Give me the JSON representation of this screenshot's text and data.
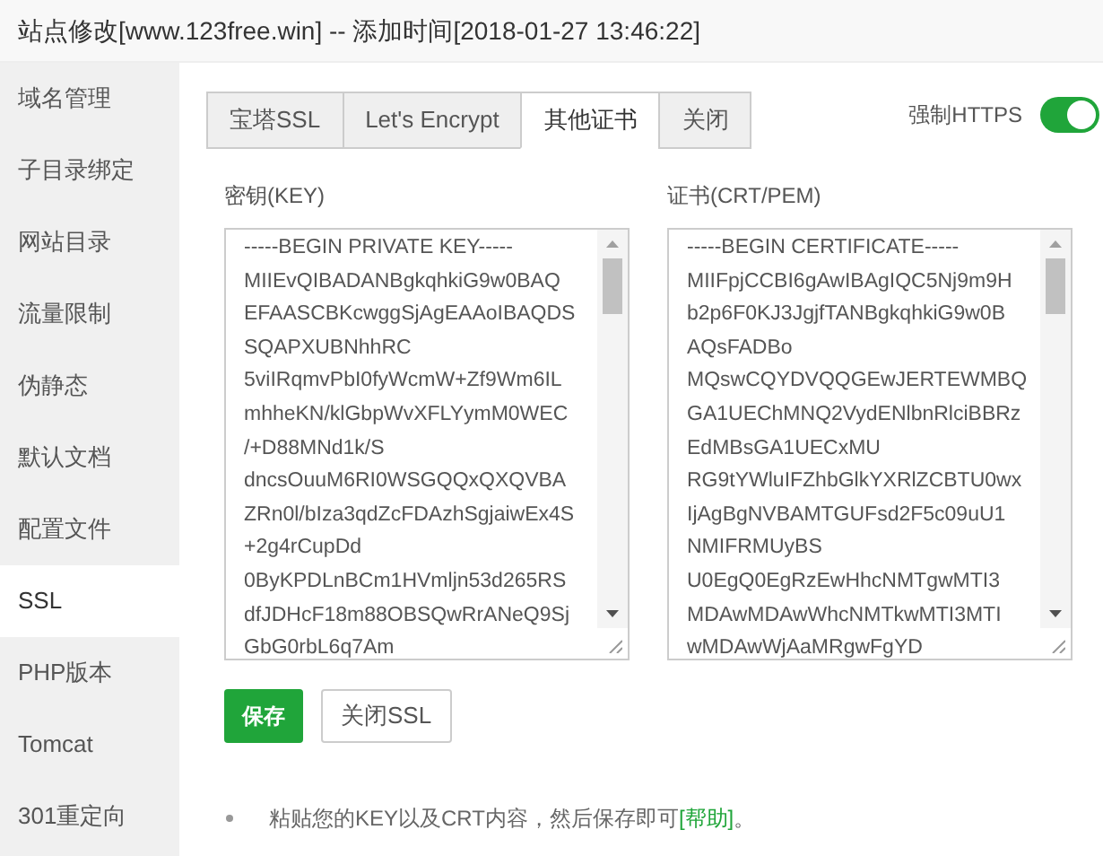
{
  "window": {
    "title": "站点修改[www.123free.win] -- 添加时间[2018-01-27 13:46:22]"
  },
  "sidebar": {
    "items": [
      {
        "label": "域名管理",
        "selected": false
      },
      {
        "label": "子目录绑定",
        "selected": false
      },
      {
        "label": "网站目录",
        "selected": false
      },
      {
        "label": "流量限制",
        "selected": false
      },
      {
        "label": "伪静态",
        "selected": false
      },
      {
        "label": "默认文档",
        "selected": false
      },
      {
        "label": "配置文件",
        "selected": false
      },
      {
        "label": "SSL",
        "selected": true
      },
      {
        "label": "PHP版本",
        "selected": false
      },
      {
        "label": "Tomcat",
        "selected": false
      },
      {
        "label": "301重定向",
        "selected": false
      }
    ]
  },
  "tabs": [
    {
      "label": "宝塔SSL",
      "selected": false
    },
    {
      "label": "Let's Encrypt",
      "selected": false
    },
    {
      "label": "其他证书",
      "selected": true
    },
    {
      "label": "关闭",
      "selected": false
    }
  ],
  "force_https": {
    "label": "强制HTTPS",
    "on": true
  },
  "fields": [
    {
      "label": "密钥(KEY)",
      "lines": [
        "-----BEGIN PRIVATE KEY-----",
        "MIIEvQIBADANBgkqhkiG9w0BAQ",
        "EFAASCBKcwggSjAgEAAoIBAQDS",
        "SQAPXUBNhhRC",
        "5viIRqmvPbI0fyWcmW+Zf9Wm6IL",
        "mhheKN/klGbpWvXFLYymM0WEC",
        "/+D88MNd1k/S",
        "dncsOuuM6RI0WSGQQxQXQVBA",
        "ZRn0l/bIza3qdZcFDAzhSgjaiwEx4S",
        "+2g4rCupDd",
        "0ByKPDLnBCm1HVmljn53d265RS",
        "dfJDHcF18m88OBSQwRrANeQ9Sj",
        "GbG0rbL6q7Am"
      ]
    },
    {
      "label": "证书(CRT/PEM)",
      "lines": [
        "-----BEGIN CERTIFICATE-----",
        "MIIFpjCCBI6gAwIBAgIQC5Nj9m9H",
        "b2p6F0KJ3JgjfTANBgkqhkiG9w0B",
        "AQsFADBo",
        "MQswCQYDVQQGEwJERTEWMBQ",
        "GA1UEChMNQ2VydENlbnRlciBBRz",
        "EdMBsGA1UECxMU",
        "RG9tYWluIFZhbGlkYXRlZCBTU0wx",
        "IjAgBgNVBAMTGUFsd2F5c09uU1",
        "NMIFRMUyBS",
        "U0EgQ0EgRzEwHhcNMTgwMTI3",
        "MDAwMDAwWhcNMTkwMTI3MTI",
        "wMDAwWjAaMRgwFgYD"
      ]
    }
  ],
  "buttons": [
    {
      "label": "保存",
      "kind": "primary"
    },
    {
      "label": "关闭SSL",
      "kind": "default"
    }
  ],
  "note": {
    "text": "粘贴您的KEY以及CRT内容，然后保存即可",
    "link": "[帮助]",
    "suffix": "。"
  }
}
